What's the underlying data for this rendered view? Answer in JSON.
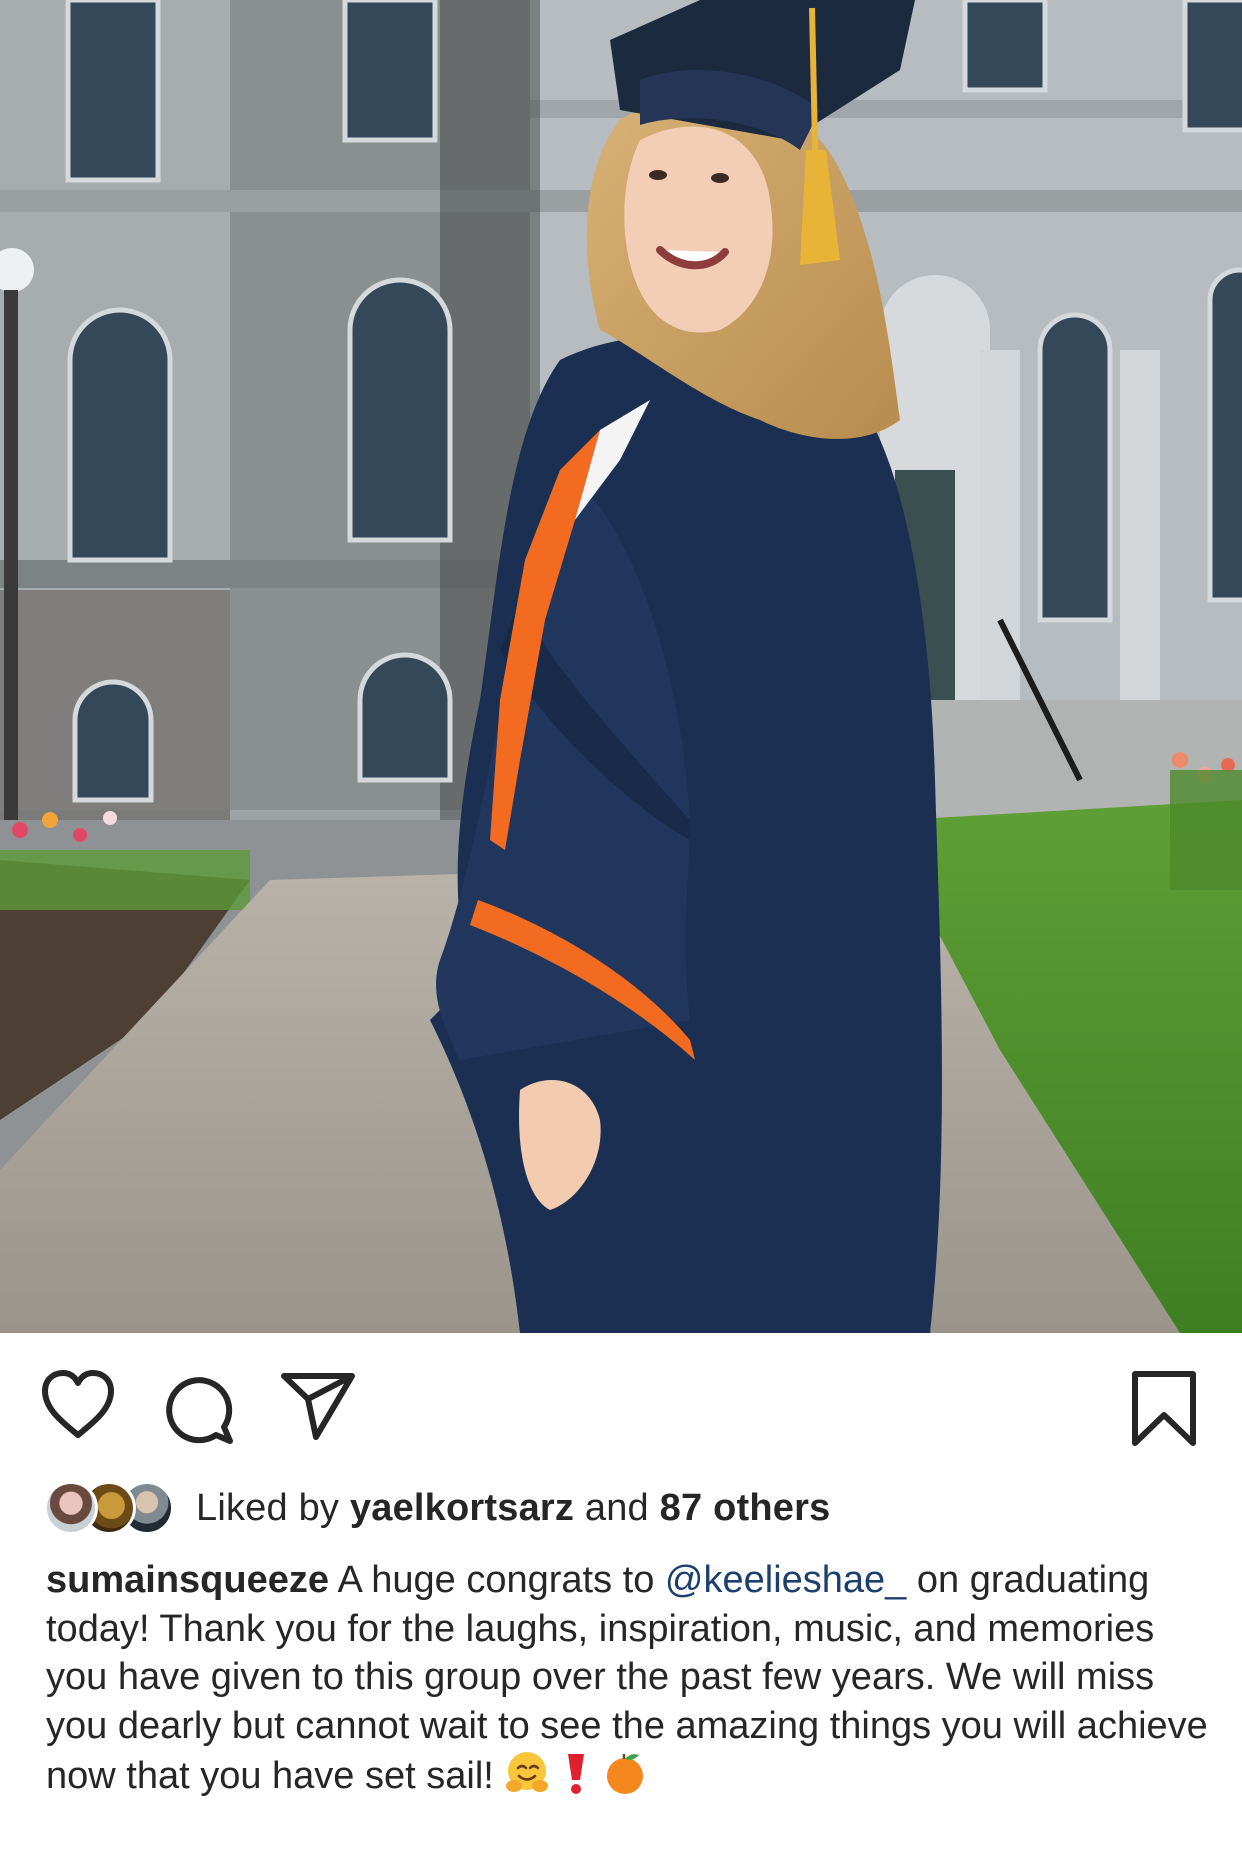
{
  "post": {
    "image_alt_name": "graduation-photo",
    "actions": {
      "like_icon": "heart-outline-icon",
      "comment_icon": "comment-bubble-icon",
      "share_icon": "paper-plane-icon",
      "save_icon": "bookmark-icon"
    },
    "likes": {
      "prefix": "Liked by",
      "first_liker": "yaelkortsarz",
      "joiner": "and",
      "others": "87 others"
    },
    "caption": {
      "username": "sumainsqueeze",
      "text_before_mention": " A huge congrats to ",
      "mention": "@keelieshae_",
      "text_after_mention": " on graduating today! Thank you for the laughs, inspiration, music, and memories you have given to this group over the past few years. We will miss you dearly but cannot wait to see the amazing things you will achieve now that you have set sail!",
      "emojis": [
        "hugging-face-emoji",
        "heavy-exclamation-mark-emoji",
        "tangerine-emoji"
      ]
    },
    "colors": {
      "text": "#262626",
      "mention": "#1d3f6e",
      "gown": "#1b2f52",
      "stole_orange": "#f26b21",
      "tassel": "#e8b437"
    }
  }
}
